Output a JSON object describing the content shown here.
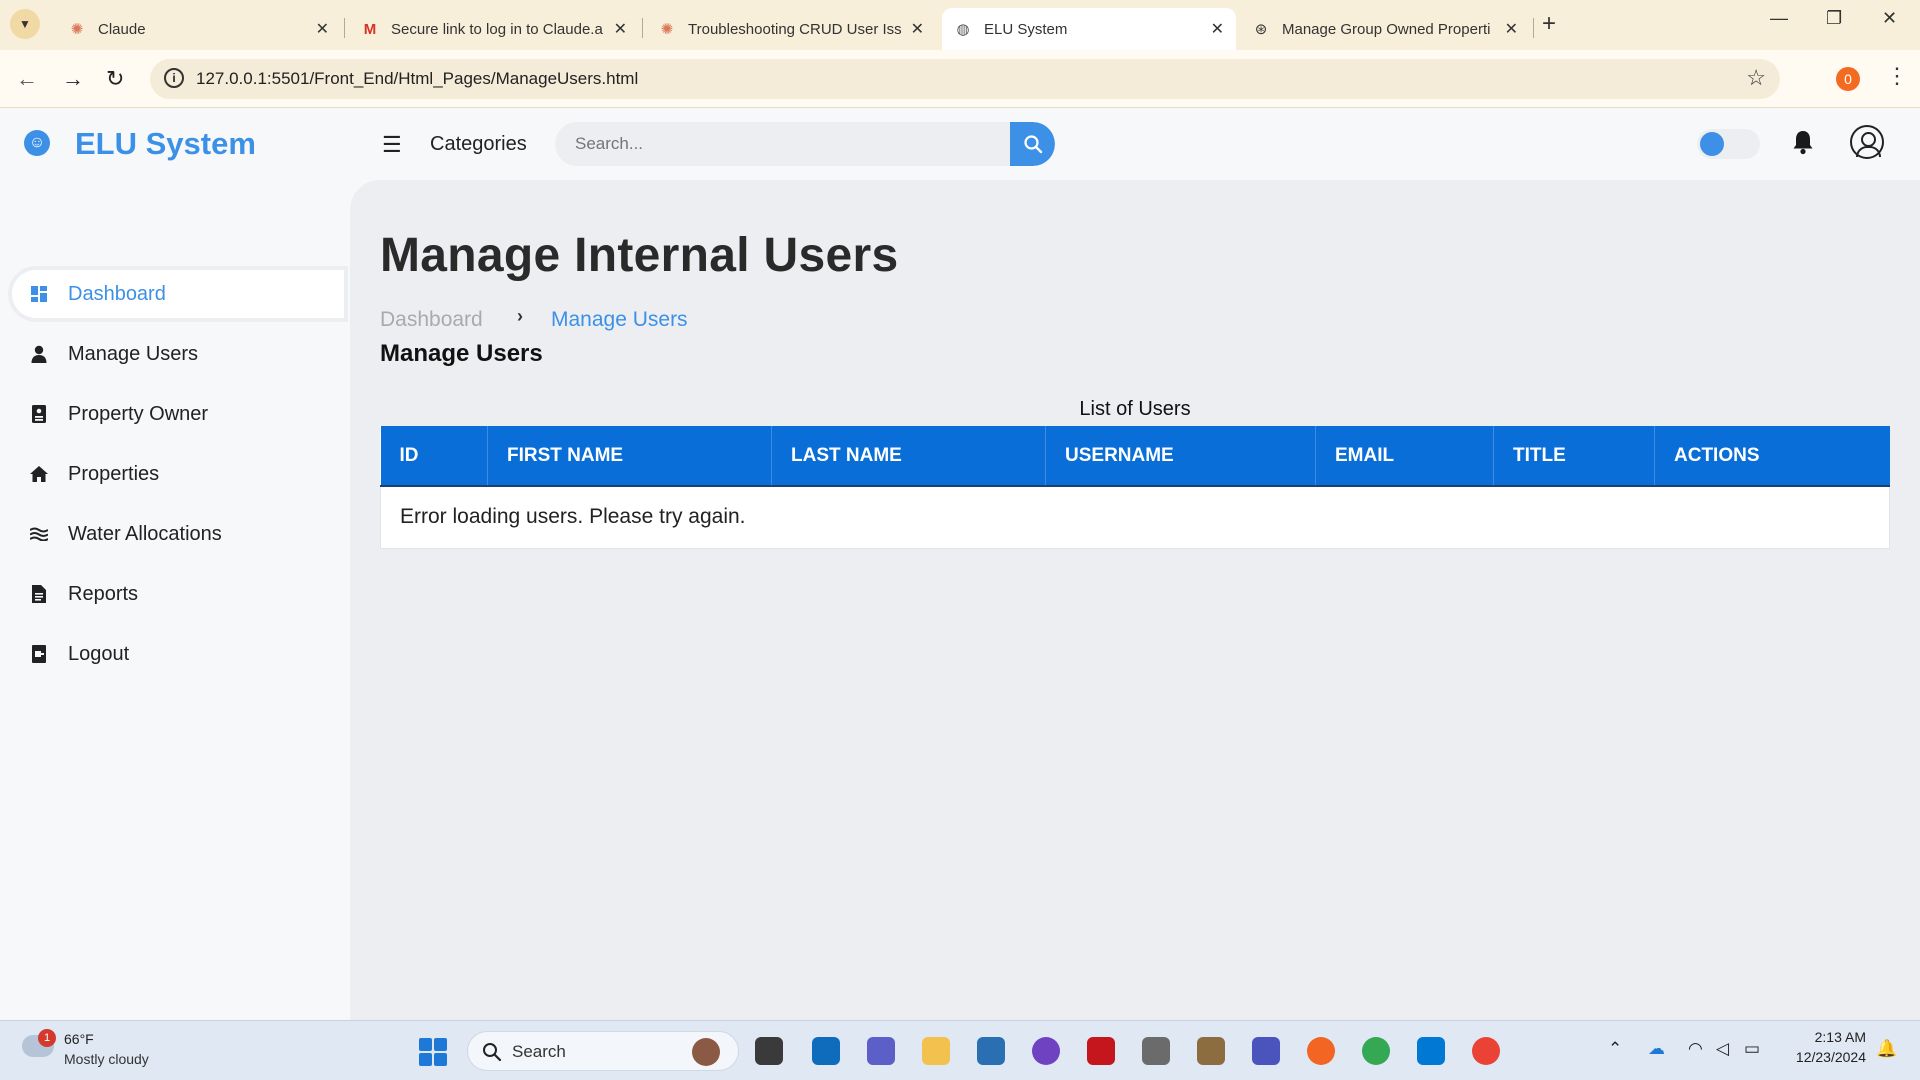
{
  "browser": {
    "tabs": [
      {
        "title": "Claude",
        "icon": "claude-icon"
      },
      {
        "title": "Secure link to log in to Claude.a",
        "icon": "gmail-icon"
      },
      {
        "title": "Troubleshooting CRUD User Iss",
        "icon": "claude-icon"
      },
      {
        "title": "ELU System",
        "icon": "globe-icon"
      },
      {
        "title": "Manage Group Owned Properti",
        "icon": "chatgpt-icon"
      }
    ],
    "url": "127.0.0.1:5501/Front_End/Html_Pages/ManageUsers.html",
    "extension_badge": "0"
  },
  "header": {
    "brand": "ELU System",
    "categories_label": "Categories",
    "search_placeholder": "Search...",
    "accent_color": "#3c91e6"
  },
  "sidebar": {
    "items": [
      {
        "label": "Dashboard",
        "icon": "dashboard-icon",
        "active": true
      },
      {
        "label": "Manage Users",
        "icon": "user-icon"
      },
      {
        "label": "Property Owner",
        "icon": "id-card-icon"
      },
      {
        "label": "Properties",
        "icon": "home-icon"
      },
      {
        "label": "Water Allocations",
        "icon": "water-icon"
      },
      {
        "label": "Reports",
        "icon": "report-icon"
      },
      {
        "label": "Logout",
        "icon": "logout-icon"
      }
    ]
  },
  "main": {
    "title": "Manage Internal Users",
    "breadcrumb": {
      "home": "Dashboard",
      "separator": "›",
      "current": "Manage Users"
    },
    "section_title": "Manage Users",
    "table": {
      "caption": "List of Users",
      "columns": [
        "ID",
        "FIRST NAME",
        "LAST NAME",
        "USERNAME",
        "EMAIL",
        "TITLE",
        "ACTIONS"
      ],
      "message": "Error loading users. Please try again.",
      "header_color": "#0a6ed8"
    }
  },
  "taskbar": {
    "weather_temp": "66°F",
    "weather_desc": "Mostly cloudy",
    "weather_badge": "1",
    "search_label": "Search",
    "time": "2:13 AM",
    "date": "12/23/2024"
  }
}
